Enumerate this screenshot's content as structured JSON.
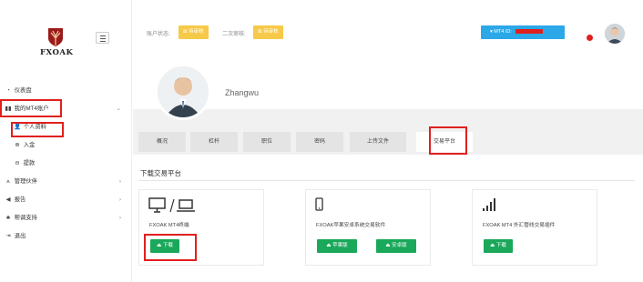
{
  "brand": {
    "name": "FXOAK"
  },
  "sidebar": {
    "items": [
      {
        "label": "仪表盘",
        "icon": "dashboard-icon"
      },
      {
        "label": "我的MT4账户",
        "icon": "account-icon"
      },
      {
        "label": "个人资料",
        "icon": "user-icon"
      },
      {
        "label": "入金",
        "icon": "plus-circle-icon"
      },
      {
        "label": "提款",
        "icon": "minus-circle-icon"
      },
      {
        "label": "管理伙伴",
        "icon": "org-icon"
      },
      {
        "label": "报告",
        "icon": "megaphone-icon"
      },
      {
        "label": "帮调支持",
        "icon": "support-icon"
      },
      {
        "label": "退出",
        "icon": "logout-icon"
      }
    ]
  },
  "header": {
    "account_status_label": "账户状态:",
    "status1": "⊠ 待审核",
    "status2_label": "二次审核:",
    "status2": "⊠ 待审核",
    "mt4_label": "MT4 ID:",
    "mt4_dropdown_symbol": "▾"
  },
  "profile": {
    "username": "Zhangwu"
  },
  "tabs": [
    "概况",
    "杠杆",
    "职位",
    "密码",
    "上传文件",
    "交易平台"
  ],
  "section": {
    "title": "下载交易平台"
  },
  "cards": [
    {
      "icon": "desktop-laptop-icon",
      "title": "FXOAK MT4终端",
      "buttons": [
        "下载"
      ]
    },
    {
      "icon": "mobile-icon",
      "title": "FXOAK苹果安卓系统交易软件",
      "buttons": [
        "苹果版",
        "安卓版"
      ]
    },
    {
      "icon": "signal-icon",
      "title": "FXOAK MT4 外汇管线交易插件",
      "buttons": [
        "下载"
      ]
    }
  ],
  "colors": {
    "accent_red": "#e0201e",
    "pending_yellow": "#f7c948",
    "mt4_blue": "#2ca8e8",
    "download_green": "#1aa85a"
  }
}
